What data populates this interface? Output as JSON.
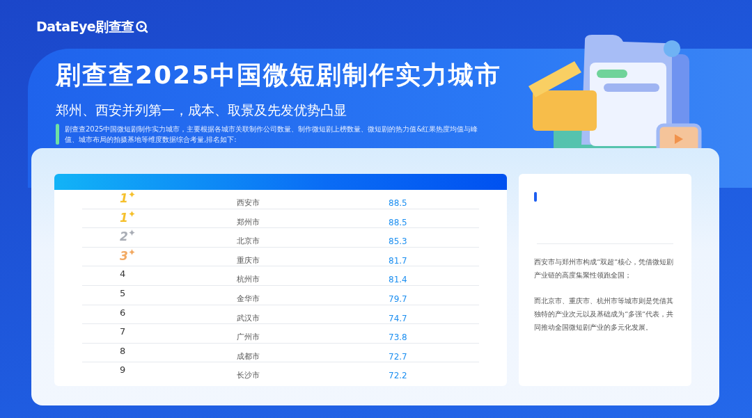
{
  "logo": {
    "text": "DataEye剧查查"
  },
  "header": {
    "title": "剧查查2025中国微短剧制作实力城市",
    "subtitle": "郑州、西安并列第一，成本、取景及先发优势凸显",
    "description": "剧查查2025中国微短剧制作实力城市，主要根据各城市关联制作公司数量、制作微短剧上榜数量、微短剧的热力值&红果热度均值与峰值、城市布局的拍摄基地等维度数据综合考量,排名如下:"
  },
  "table": {
    "rows": [
      {
        "rank": "1",
        "kind": "medal",
        "color": "#f5c02c",
        "city": "西安市",
        "score": "88.5"
      },
      {
        "rank": "1",
        "kind": "medal",
        "color": "#f5c02c",
        "city": "郑州市",
        "score": "88.5"
      },
      {
        "rank": "2",
        "kind": "medal",
        "color": "#a9adb5",
        "city": "北京市",
        "score": "85.3"
      },
      {
        "rank": "3",
        "kind": "medal",
        "color": "#f2a962",
        "city": "重庆市",
        "score": "81.7"
      },
      {
        "rank": "4",
        "kind": "plain",
        "city": "杭州市",
        "score": "81.4"
      },
      {
        "rank": "5",
        "kind": "plain",
        "city": "金华市",
        "score": "79.7"
      },
      {
        "rank": "6",
        "kind": "plain",
        "city": "武汉市",
        "score": "74.7"
      },
      {
        "rank": "7",
        "kind": "plain",
        "city": "广州市",
        "score": "73.8"
      },
      {
        "rank": "8",
        "kind": "plain",
        "city": "成都市",
        "score": "72.7"
      },
      {
        "rank": "9",
        "kind": "plain",
        "city": "长沙市",
        "score": "72.2"
      }
    ]
  },
  "summary": {
    "paragraphs": [
      "西安市与郑州市构成“双超”核心，凭借微短剧产业链的高度集聚性领跑全国；",
      "而北京市、重庆市、杭州市等城市则是凭借其独特的产业次元以及基础成为“多强”代表，共同推动全国微短剧产业的多元化发展。"
    ]
  }
}
